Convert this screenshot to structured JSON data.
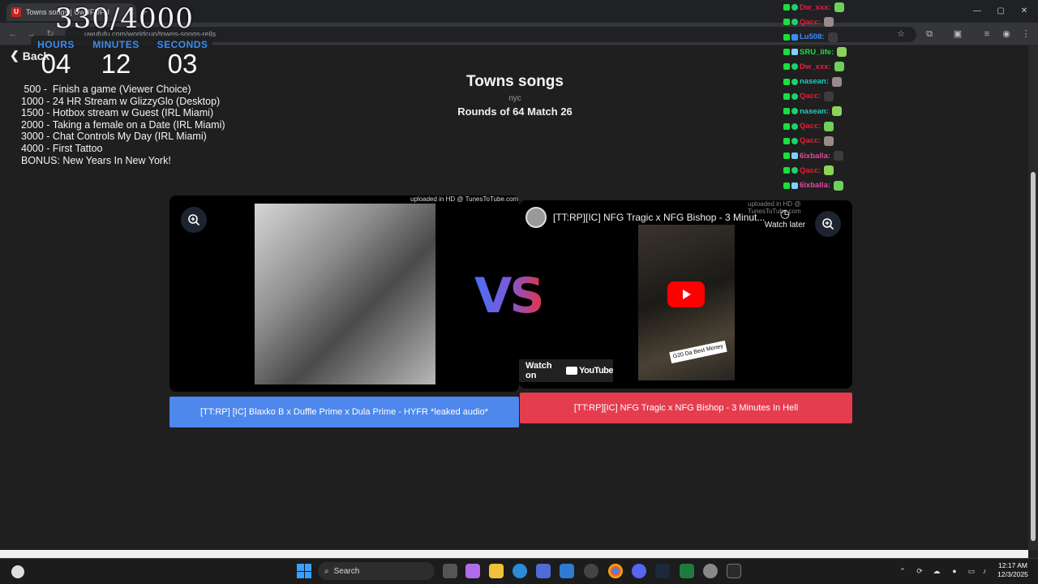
{
  "browser": {
    "tab_title": "Towns songs | UwUFUFU",
    "url": "uwufufu.com/worldcup/towns-songs-rells",
    "new_tab": "+",
    "tab_close": "✕"
  },
  "overlay": {
    "counter": "330/4000",
    "timer": {
      "hours_label": "HOURS",
      "hours": "04",
      "minutes_label": "MINUTES",
      "minutes": "12",
      "seconds_label": "SECONDS",
      "seconds": "03"
    },
    "goals": [
      " 500 -  Finish a game (Viewer Choice)",
      "1000 - 24 HR Stream w GlizzyGlo (Desktop)",
      "1500 - Hotbox stream w Guest (IRL Miami)",
      "2000 - Taking a female on a Date (IRL Miami)",
      "3000 - Chat Controls My Day (IRL Miami)",
      "4000 - First Tattoo",
      "BONUS: New Years In New York!"
    ]
  },
  "page": {
    "back_label": "Back",
    "title": "Towns songs",
    "subtitle": "nyc",
    "round": "Rounds of 64 Match 26",
    "vs": "VS",
    "left": {
      "credit": "uploaded in HD @ TunesToTube.com",
      "choice_label": "[TT:RP] [IC] Blaxko B x Duffle Prime x Dula Prime - HYFR *leaked audio*"
    },
    "right": {
      "credit": "uploaded in HD @ TunesToTube.com",
      "video_title": "[TT:RP][IC] NFG Tragic x NFG Bishop - 3 Minut...",
      "watch_later": "Watch later",
      "watch_on": "Watch on",
      "youtube": "YouTube",
      "money_tag": "G20 Da Best Money",
      "choice_label": "[TT:RP][IC] NFG Tragic x NFG Bishop - 3 Minutes In Hell"
    }
  },
  "chat": [
    {
      "user": "Dw_xxx:",
      "color": "#e0213a"
    },
    {
      "user": "Qacc:",
      "color": "#e0213a"
    },
    {
      "user": "Lu508:",
      "color": "#3b8cff"
    },
    {
      "user": "SRU_life:",
      "color": "#19e03a"
    },
    {
      "user": "Dw_xxx:",
      "color": "#e0213a"
    },
    {
      "user": "nasean:",
      "color": "#19d0c0"
    },
    {
      "user": "Qacc:",
      "color": "#e0213a"
    },
    {
      "user": "nasean:",
      "color": "#19d0c0"
    },
    {
      "user": "Qacc:",
      "color": "#e0213a"
    },
    {
      "user": "Qacc:",
      "color": "#e0213a"
    },
    {
      "user": "6ixballa:",
      "color": "#e04aa0"
    },
    {
      "user": "Qacc:",
      "color": "#e0213a"
    },
    {
      "user": "6ixballa:",
      "color": "#e04aa0"
    }
  ],
  "taskbar": {
    "search": "Search",
    "time": "12:17 AM",
    "date": "12/3/2025"
  }
}
